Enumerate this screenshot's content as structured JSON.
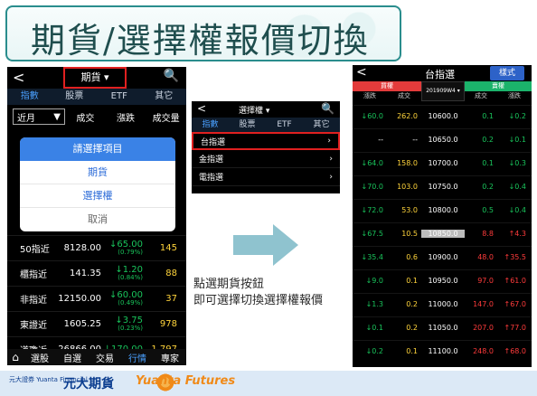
{
  "title": "期貨/選擇權報價切換",
  "left_phone": {
    "back": "<",
    "title": "期貨 ▾",
    "search": "🔍",
    "tabs": [
      "指數",
      "股票",
      "ETF",
      "其它"
    ],
    "sub": {
      "month": "近月",
      "cols": [
        "成交",
        "漲跌",
        "成交量"
      ]
    },
    "popup": {
      "header": "請選擇項目",
      "items": [
        "期貨",
        "選擇權",
        "取消"
      ]
    },
    "rows": [
      {
        "name": "50指近",
        "value": "8128.00",
        "change": "65.00",
        "pct": "(0.79%)",
        "volume": "145"
      },
      {
        "name": "櫃指近",
        "value": "141.35",
        "change": "1.20",
        "pct": "(0.84%)",
        "volume": "88"
      },
      {
        "name": "非指近",
        "value": "12150.00",
        "change": "60.00",
        "pct": "(0.49%)",
        "volume": "37"
      },
      {
        "name": "東證近",
        "value": "1605.25",
        "change": "3.75",
        "pct": "(0.23%)",
        "volume": "978"
      },
      {
        "name": "道瓊近",
        "value": "26866.00",
        "change": "170.00",
        "pct": "",
        "volume": "1,797"
      }
    ],
    "nav": [
      "選股",
      "自選",
      "交易",
      "行情",
      "專家"
    ]
  },
  "middle_phone": {
    "back": "<",
    "title": "選擇權 ▾",
    "search": "🔍",
    "tabs": [
      "指數",
      "股票",
      "ETF",
      "其它"
    ],
    "items": [
      "台指選",
      "金指選",
      "電指選"
    ]
  },
  "instruction": [
    "點選期貨按鈕",
    "即可選擇切換選擇權報價"
  ],
  "right_phone": {
    "back": "<",
    "title": "台指選",
    "mode_btn": "樣式",
    "call": "買權",
    "put": "賣權",
    "month": "201909W4 ▾",
    "cols": [
      "漲跌",
      "成交",
      "",
      "成交",
      "漲跌"
    ],
    "rows": [
      {
        "c1": "60.0",
        "c2": "262.0",
        "strike": "10600.0",
        "c4": "0.1",
        "c5": "0.2"
      },
      {
        "c1": "--",
        "c2": "--",
        "strike": "10650.0",
        "c4": "0.2",
        "c5": "0.1"
      },
      {
        "c1": "64.0",
        "c2": "158.0",
        "strike": "10700.0",
        "c4": "0.1",
        "c5": "0.3"
      },
      {
        "c1": "70.0",
        "c2": "103.0",
        "strike": "10750.0",
        "c4": "0.2",
        "c5": "0.4"
      },
      {
        "c1": "72.0",
        "c2": "53.0",
        "strike": "10800.0",
        "c4": "0.5",
        "c5": "0.4"
      },
      {
        "c1": "67.5",
        "c2": "10.5",
        "strike": "10850.0",
        "c4": "8.8",
        "c5": "4.3"
      },
      {
        "c1": "35.4",
        "c2": "0.6",
        "strike": "10900.0",
        "c4": "48.0",
        "c5": "35.5"
      },
      {
        "c1": "9.0",
        "c2": "0.1",
        "strike": "10950.0",
        "c4": "97.0",
        "c5": "61.0"
      },
      {
        "c1": "1.3",
        "c2": "0.2",
        "strike": "11000.0",
        "c4": "147.0",
        "c5": "67.0"
      },
      {
        "c1": "0.1",
        "c2": "0.2",
        "strike": "11050.0",
        "c4": "207.0",
        "c5": "77.0"
      },
      {
        "c1": "0.2",
        "c2": "0.1",
        "strike": "11100.0",
        "c4": "248.0",
        "c5": "68.0"
      }
    ]
  },
  "footer": {
    "brand_small": "元大證券\nYuanta Financial",
    "brand_main": "元大期貨",
    "brand_en": "Yuanta Futures"
  }
}
